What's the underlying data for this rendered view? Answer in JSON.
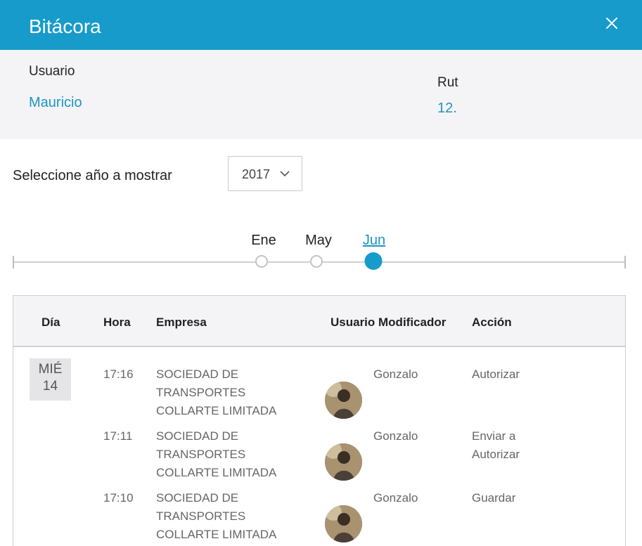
{
  "dialog": {
    "title": "Bitácora",
    "close_icon": "close-icon"
  },
  "user_info": {
    "usuario_label": "Usuario",
    "usuario_value": "Mauricio",
    "rut_label": "Rut",
    "rut_value": "12."
  },
  "year_filter": {
    "label": "Seleccione año a mostrar",
    "selected": "2017"
  },
  "timeline": {
    "months": [
      {
        "label": "Ene",
        "active": false
      },
      {
        "label": "May",
        "active": false
      },
      {
        "label": "Jun",
        "active": true
      }
    ]
  },
  "table": {
    "headers": {
      "dia": "Día",
      "hora": "Hora",
      "empresa": "Empresa",
      "usuario_modificador": "Usuario Modificador",
      "accion": "Acción"
    },
    "day": {
      "dow": "MIÉ",
      "num": "14"
    },
    "rows": [
      {
        "hora": "17:16",
        "empresa": "SOCIEDAD DE TRANSPORTES COLLARTE LIMITADA",
        "usuario": "Gonzalo",
        "accion": "Autorizar"
      },
      {
        "hora": "17:11",
        "empresa": "SOCIEDAD DE TRANSPORTES COLLARTE LIMITADA",
        "usuario": "Gonzalo",
        "accion": "Enviar a Autorizar"
      },
      {
        "hora": "17:10",
        "empresa": "SOCIEDAD DE TRANSPORTES COLLARTE LIMITADA",
        "usuario": "Gonzalo",
        "accion": "Guardar"
      }
    ]
  },
  "colors": {
    "accent": "#169bcb",
    "link": "#1d95c4",
    "panel_bg": "#f4f4f6"
  }
}
